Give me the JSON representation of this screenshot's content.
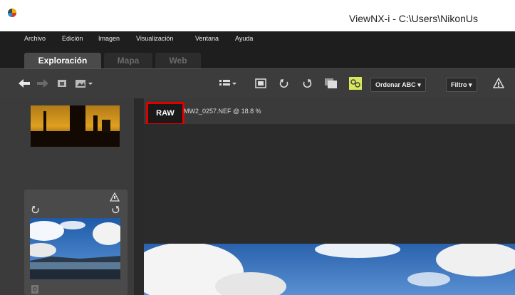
{
  "window": {
    "title": "ViewNX-i - C:\\Users\\NikonUs"
  },
  "menu": {
    "items": [
      "Archivo",
      "Edición",
      "Imagen",
      "Visualización",
      "Ventana",
      "Ayuda"
    ]
  },
  "tabs": [
    {
      "label": "Exploración",
      "active": true
    },
    {
      "label": "Mapa",
      "active": false
    },
    {
      "label": "Web",
      "active": false
    }
  ],
  "toolbar": {
    "sort_label": "Ordenar ABC",
    "filter_label": "Filtro",
    "icons": [
      "back-arrow-icon",
      "forward-arrow-icon",
      "folder-icon",
      "image-dropdown-icon",
      "list-view-icon",
      "single-view-icon",
      "rotate-left-icon",
      "rotate-right-icon",
      "compare-icon",
      "sync-icon",
      "warning-icon"
    ]
  },
  "viewer": {
    "format_badge": "RAW",
    "file_info": "MW2_0257.NEF @ 18.8 %"
  },
  "thumbnail": {
    "badge": "0"
  },
  "colors": {
    "highlight": "#e00000",
    "dark_bg": "#1e1e1e",
    "toolbar_bg": "#3c3c3c",
    "sync_icon": "#d8e85a"
  }
}
